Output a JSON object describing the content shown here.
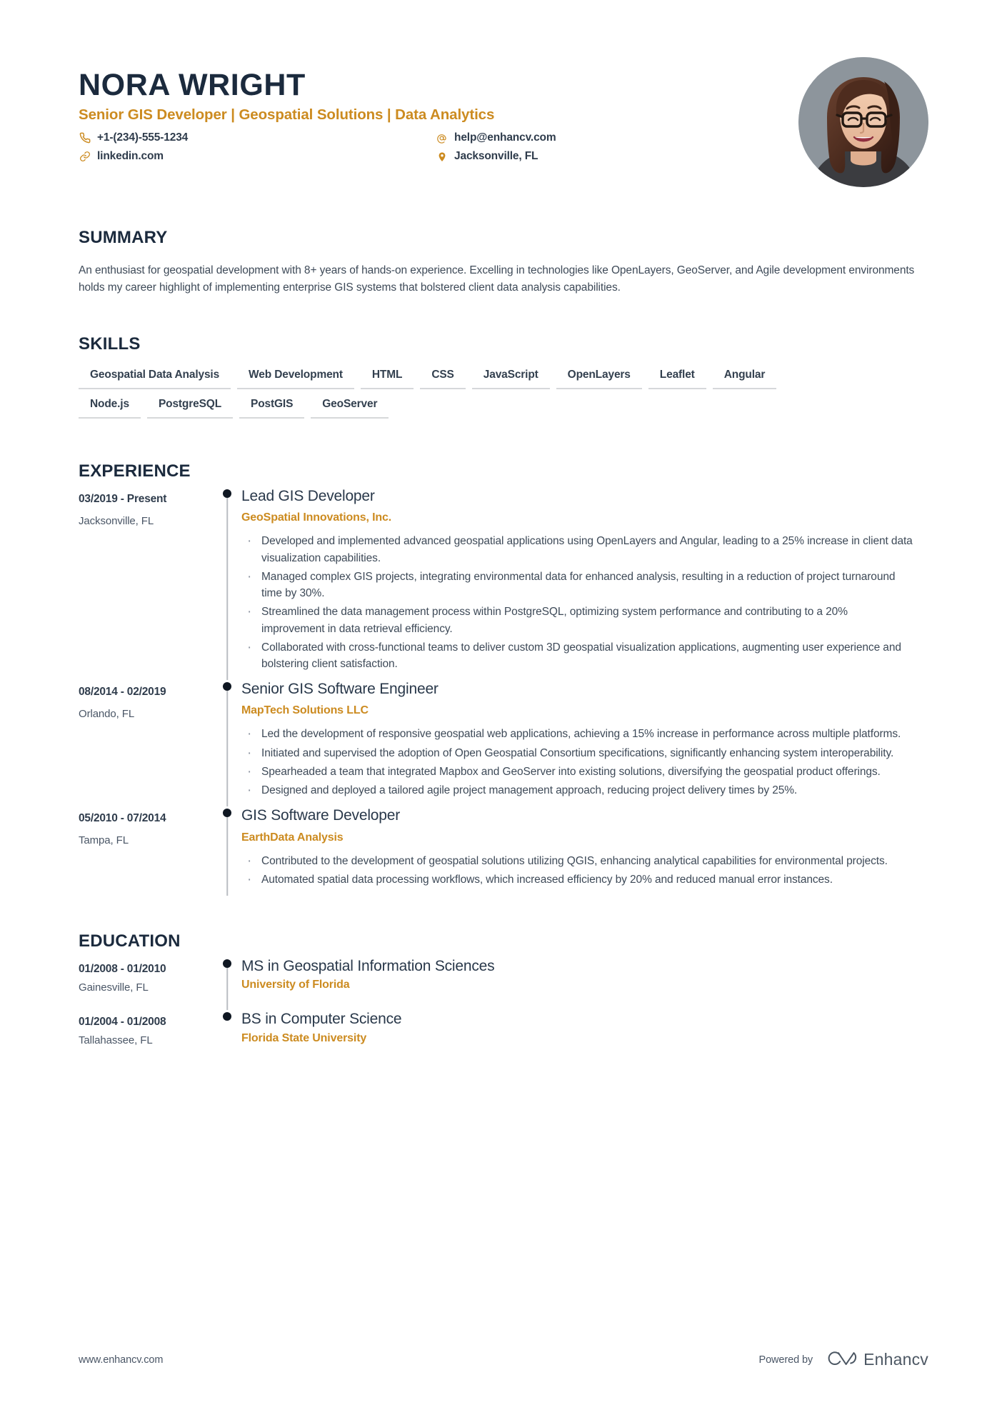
{
  "theme": {
    "accent": "#cc8b20",
    "heading": "#1b2a3d",
    "body_text": "#3e4a58",
    "rule": "#d6d8da",
    "timeline": "#0f1722"
  },
  "header": {
    "full_name": "NORA WRIGHT",
    "headline": "Senior GIS Developer | Geospatial Solutions | Data Analytics",
    "contacts": [
      {
        "icon": "phone-icon",
        "value": "+1-(234)-555-1234"
      },
      {
        "icon": "email-icon",
        "value": "help@enhancv.com"
      },
      {
        "icon": "link-icon",
        "value": "linkedin.com"
      },
      {
        "icon": "location-icon",
        "value": "Jacksonville, FL"
      }
    ],
    "avatar_alt": "profile-photo"
  },
  "summary": {
    "title": "SUMMARY",
    "text": "An enthusiast for geospatial development with 8+ years of hands-on experience. Excelling in technologies like OpenLayers, GeoServer, and Agile development environments holds my career highlight of implementing enterprise GIS systems that bolstered client data analysis capabilities."
  },
  "skills": {
    "title": "SKILLS",
    "rows": [
      [
        "Geospatial Data Analysis",
        "Web Development",
        "HTML",
        "CSS",
        "JavaScript",
        "OpenLayers",
        "Leaflet",
        "Angular"
      ],
      [
        "Node.js",
        "PostgreSQL",
        "PostGIS",
        "GeoServer"
      ]
    ]
  },
  "experience": {
    "title": "EXPERIENCE",
    "entries": [
      {
        "dates": "03/2019 - Present",
        "location": "Jacksonville, FL",
        "title": "Lead GIS Developer",
        "company": "GeoSpatial Innovations, Inc.",
        "bullets": [
          "Developed and implemented advanced geospatial applications using OpenLayers and Angular, leading to a 25% increase in client data visualization capabilities.",
          "Managed complex GIS projects, integrating environmental data for enhanced analysis, resulting in a reduction of project turnaround time by 30%.",
          "Streamlined the data management process within PostgreSQL, optimizing system performance and contributing to a 20% improvement in data retrieval efficiency.",
          "Collaborated with cross-functional teams to deliver custom 3D geospatial visualization applications, augmenting user experience and bolstering client satisfaction."
        ]
      },
      {
        "dates": "08/2014 - 02/2019",
        "location": "Orlando, FL",
        "title": "Senior GIS Software Engineer",
        "company": "MapTech Solutions LLC",
        "bullets": [
          "Led the development of responsive geospatial web applications, achieving a 15% increase in performance across multiple platforms.",
          "Initiated and supervised the adoption of Open Geospatial Consortium specifications, significantly enhancing system interoperability.",
          "Spearheaded a team that integrated Mapbox and GeoServer into existing solutions, diversifying the geospatial product offerings.",
          "Designed and deployed a tailored agile project management approach, reducing project delivery times by 25%."
        ]
      },
      {
        "dates": "05/2010 - 07/2014",
        "location": "Tampa, FL",
        "title": "GIS Software Developer",
        "company": "EarthData Analysis",
        "bullets": [
          "Contributed to the development of geospatial solutions utilizing QGIS, enhancing analytical capabilities for environmental projects.",
          "Automated spatial data processing workflows, which increased efficiency by 20% and reduced manual error instances."
        ]
      }
    ]
  },
  "education": {
    "title": "EDUCATION",
    "entries": [
      {
        "dates": "01/2008 - 01/2010",
        "location": "Gainesville, FL",
        "title": "MS in Geospatial Information Sciences",
        "company": "University of Florida"
      },
      {
        "dates": "01/2004 - 01/2008",
        "location": "Tallahassee, FL",
        "title": "BS in Computer Science",
        "company": "Florida State University"
      }
    ]
  },
  "footer": {
    "url": "www.enhancv.com",
    "powered_by": "Powered by",
    "brand": "Enhancv"
  }
}
